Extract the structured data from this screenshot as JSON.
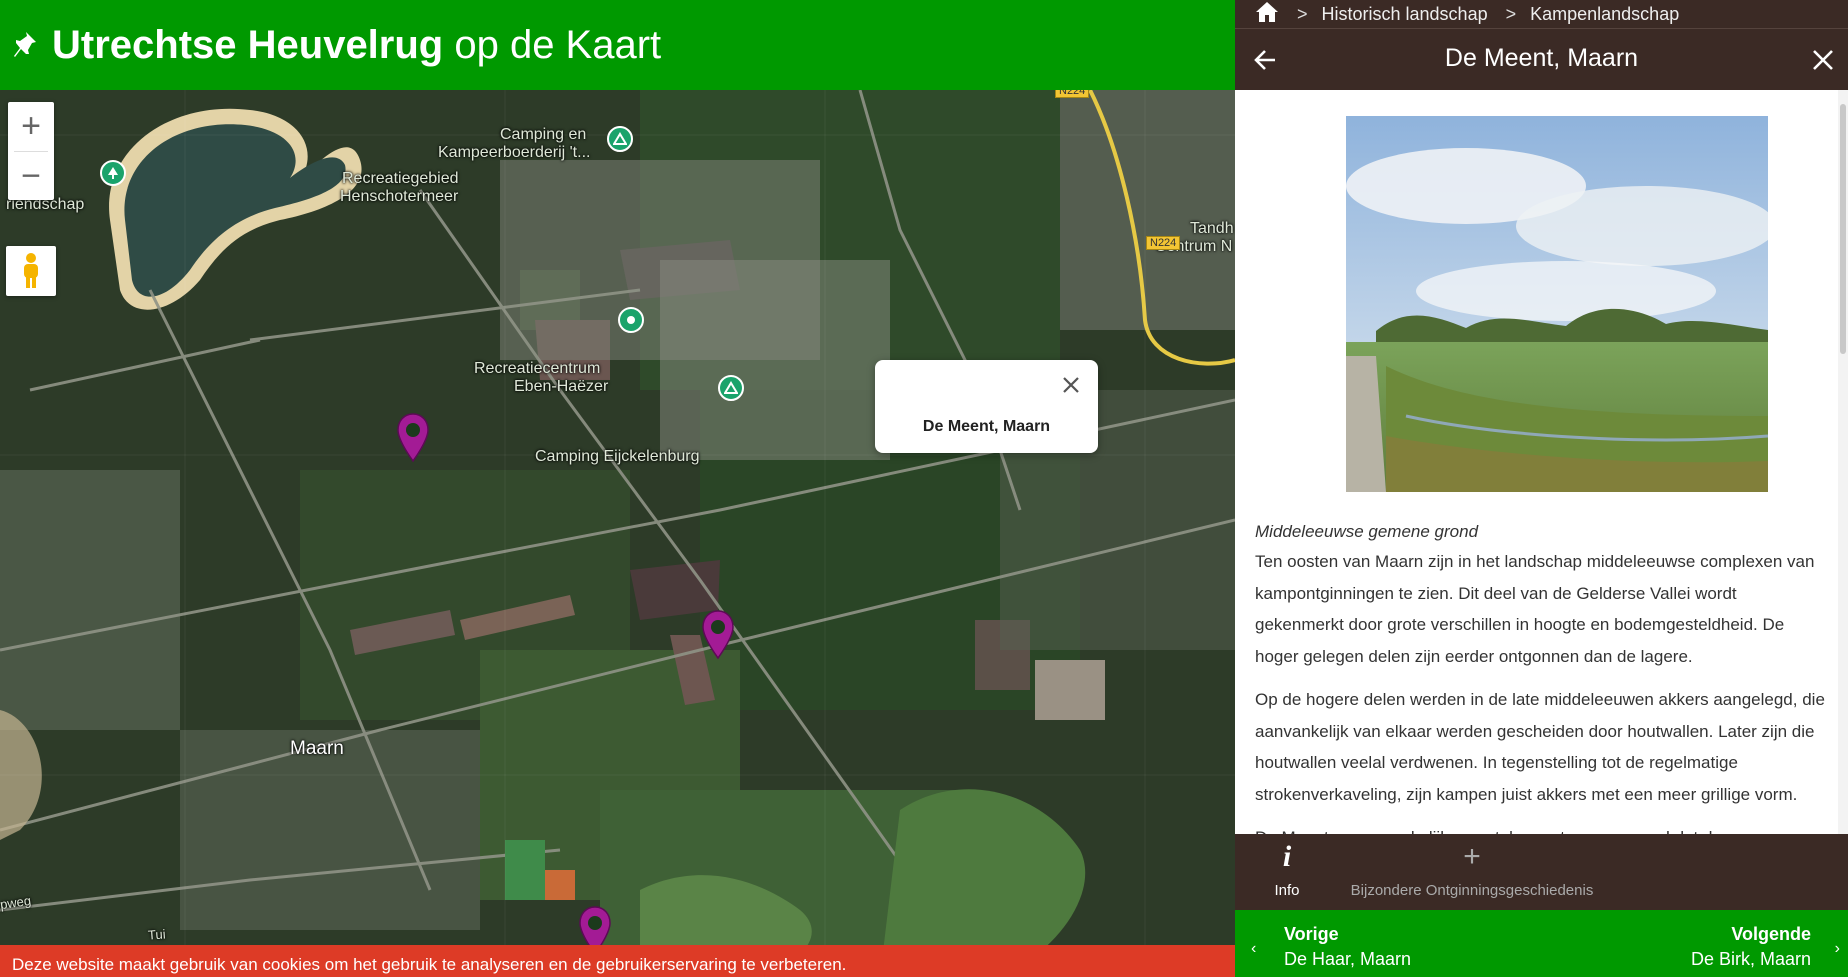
{
  "header": {
    "title_bold": "Utrechtse Heuvelrug",
    "title_rest": " op de Kaart",
    "pin_icon": "pushpin-icon"
  },
  "map": {
    "labels": {
      "camping_en": "Camping en",
      "kampeerboerderij": "Kampeerboerderij 't...",
      "recreatiegebied": "Recreatiegebied",
      "henschotermeer": "Henschotermeer",
      "vriendschap": "riendschap",
      "recreatiecentrum": "Recreatiecentrum",
      "eben_haezer": "Eben-Haëzer",
      "camping_eijckelenburg": "Camping Eijckelenburg",
      "tandh": "Tandh",
      "centrum_n": "Centrum N",
      "maarn": "Maarn",
      "pweg": "pweg",
      "tuin": "Tui"
    },
    "road_n224_a": "N224",
    "road_n224_b": "N224",
    "zoom_in": "+",
    "zoom_out": "−",
    "popup_title": "De Meent, Maarn"
  },
  "cookie": {
    "text": "Deze website maakt gebruik van cookies om het gebruik te analyseren en de gebruikerservaring te verbeteren."
  },
  "panel": {
    "breadcrumb": {
      "home_icon": "home-icon",
      "item1": "Historisch landschap",
      "item2": "Kampenlandschap"
    },
    "title": "De Meent, Maarn",
    "subtitle": "Middeleeuwse gemene grond",
    "paragraphs": [
      "Ten oosten van Maarn zijn in het landschap middeleeuwse complexen van kampontginningen te zien. Dit deel van de Gelderse Vallei wordt gekenmerkt door grote verschillen in hoogte en bodemgesteldheid. De hoger gelegen delen zijn eerder ontgonnen dan de lagere.",
      "Op de hogere delen werden in de late middeleeuwen akkers aangelegd, die aanvankelijk van elkaar werden gescheiden door houtwallen. Later zijn die houtwallen veelal verdwenen. In tegenstelling tot de regelmatige strokenverkaveling, zijn kampen juist akkers met een meer grillige vorm.",
      "De Meent - oorspronkelijk een stuk onontgonnen grond dat door"
    ],
    "tabs": {
      "info_icon": "i",
      "info": "Info",
      "extra_icon": "+",
      "extra": "Bijzondere Ontginningsgeschiedenis"
    },
    "nav": {
      "prev_label": "Vorige",
      "prev_name": "De Haar, Maarn",
      "next_label": "Volgende",
      "next_name": "De Birk, Maarn",
      "prev_arrow": "‹",
      "next_arrow": "›"
    }
  }
}
